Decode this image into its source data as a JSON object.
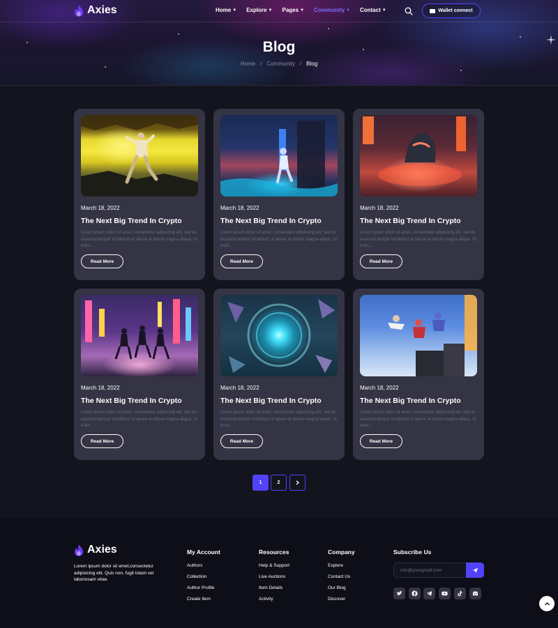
{
  "header": {
    "brand": "Axies",
    "nav": [
      {
        "label": "Home",
        "active": false
      },
      {
        "label": "Explore",
        "active": false
      },
      {
        "label": "Pages",
        "active": false
      },
      {
        "label": "Community",
        "active": true
      },
      {
        "label": "Contact",
        "active": false
      }
    ],
    "search_icon": "search-icon",
    "wallet_label": "Wallet connect"
  },
  "page": {
    "title": "Blog",
    "breadcrumb": [
      "Home",
      "Community",
      "Blog"
    ],
    "separator": "/"
  },
  "posts": [
    {
      "date": "March 18, 2022",
      "title": "The Next Big Trend In Crypto",
      "excerpt": "Lorem ipsum dolor sit amet, consectetur adipiscing elit, sed do eiusmod tempor incididunt ut labore et dolore magna aliqua. Ut enim...",
      "button": "Read More",
      "image": "yellow-cave-fighter"
    },
    {
      "date": "March 18, 2022",
      "title": "The Next Big Trend In Crypto",
      "excerpt": "Lorem ipsum dolor sit amet, consectetur adipiscing elit, sed do eiusmod tempor incididunt ut labore et dolore magna aliqua. Ut enim...",
      "button": "Read More",
      "image": "blue-neon-runner"
    },
    {
      "date": "March 18, 2022",
      "title": "The Next Big Trend In Crypto",
      "excerpt": "Lorem ipsum dolor sit amet, consectetur adipiscing elit, sed do eiusmod tempor incididunt ut labore et dolore magna aliqua. Ut enim...",
      "button": "Read More",
      "image": "red-robot-explosion"
    },
    {
      "date": "March 18, 2022",
      "title": "The Next Big Trend In Crypto",
      "excerpt": "Lorem ipsum dolor sit amet, consectetur adipiscing elit, sed do eiusmod tempor incididunt ut labore et dolore magna aliqua. Ut enim...",
      "button": "Read More",
      "image": "neon-dancers"
    },
    {
      "date": "March 18, 2022",
      "title": "The Next Big Trend In Crypto",
      "excerpt": "Lorem ipsum dolor sit amet, consectetur adipiscing elit, sed do eiusmod tempor incididunt ut labore et dolore magna aliqua. Ut enim...",
      "button": "Read More",
      "image": "cyan-portal"
    },
    {
      "date": "March 18, 2022",
      "title": "The Next Big Trend In Crypto",
      "excerpt": "Lorem ipsum dolor sit amet, consectetur adipiscing elit, sed do eiusmod tempor incididunt ut labore et dolore magna aliqua. Ut enim...",
      "button": "Read More",
      "image": "skydiving-heroes"
    }
  ],
  "pagination": {
    "pages": [
      "1",
      "2"
    ],
    "current": "1",
    "next_icon": "chevron-right-icon"
  },
  "footer": {
    "brand": "Axies",
    "description": "Lorem ipsum dolor sit amet,consectetur adipisicing elit. Quis non, fugit totam vel laboriosam vitae.",
    "columns": [
      {
        "title": "My Account",
        "links": [
          "Authors",
          "Collection",
          "Author Profile",
          "Create Item"
        ]
      },
      {
        "title": "Resources",
        "links": [
          "Help & Support",
          "Live Auctions",
          "Item Details",
          "Activity"
        ]
      },
      {
        "title": "Company",
        "links": [
          "Explore",
          "Contact Us",
          "Our Blog",
          "Discover"
        ]
      }
    ],
    "subscribe": {
      "title": "Subscribe Us",
      "placeholder": "info@yourgmail.com",
      "button_icon": "send-icon"
    },
    "socials": [
      "twitter-icon",
      "facebook-icon",
      "telegram-icon",
      "youtube-icon",
      "tiktok-icon",
      "discord-icon"
    ]
  },
  "colors": {
    "accent": "#5142fc",
    "card": "#343444",
    "background": "#14141f",
    "footer": "#0e0e18"
  }
}
